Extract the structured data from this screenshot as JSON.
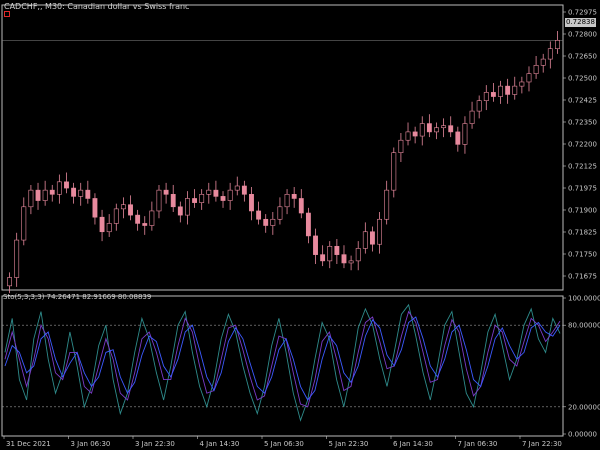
{
  "window": {
    "title": "CADCHF,, M30:  Canadian dollar vs Swiss franc",
    "last_price": "0.72838"
  },
  "indicator": {
    "label": "Sto(5,3,3,3) 74.26471 82.91669 80.08839"
  },
  "colors": {
    "background": "#000000",
    "candle": "#e88a9e",
    "axis": "#c8c8c8",
    "stoch_main": "#2e8b8b",
    "stoch_signal": "#7a3cc8",
    "stoch_third": "#3c5aff"
  },
  "chart_data": [
    {
      "type": "candlestick",
      "title": "CADCHF,, M30:  Canadian dollar vs Swiss franc",
      "y_ticks": [
        "0.72975",
        "0.72800",
        "0.72650",
        "0.72500",
        "0.72425",
        "0.72350",
        "0.72200",
        "0.72125",
        "0.71975",
        "0.71900",
        "0.71825",
        "0.71750",
        "0.71675"
      ],
      "x_ticks": [
        "31 Dec 2021",
        "3 Jan 06:30",
        "3 Jan 22:30",
        "4 Jan 14:30",
        "5 Jan 06:30",
        "5 Jan 22:30",
        "6 Jan 14:30",
        "7 Jan 06:30",
        "7 Jan 22:30"
      ],
      "ylim": [
        0.7164,
        0.7301
      ],
      "close": [
        0.717,
        0.7188,
        0.7204,
        0.7212,
        0.7207,
        0.7212,
        0.721,
        0.7216,
        0.7213,
        0.7209,
        0.7212,
        0.7208,
        0.7199,
        0.7192,
        0.7196,
        0.7203,
        0.7205,
        0.72,
        0.7196,
        0.7195,
        0.7202,
        0.7212,
        0.721,
        0.7204,
        0.72,
        0.7208,
        0.7206,
        0.721,
        0.7212,
        0.7209,
        0.7207,
        0.7212,
        0.7214,
        0.721,
        0.7202,
        0.7198,
        0.7195,
        0.7198,
        0.7204,
        0.721,
        0.7208,
        0.7201,
        0.719,
        0.7181,
        0.7178,
        0.7185,
        0.7181,
        0.7177,
        0.7178,
        0.7184,
        0.7192,
        0.7186,
        0.7198,
        0.7212,
        0.723,
        0.7236,
        0.724,
        0.7238,
        0.7244,
        0.724,
        0.7242,
        0.7243,
        0.724,
        0.7234,
        0.7244,
        0.725,
        0.7255,
        0.7259,
        0.7257,
        0.7262,
        0.7258,
        0.7262,
        0.7264,
        0.7268,
        0.7272,
        0.7275,
        0.728,
        0.7284
      ],
      "ohlc_note": "open of each bar equals previous close"
    },
    {
      "type": "line",
      "title": "Sto(5,3,3,3) 74.26471 82.91669 80.08839",
      "y_ticks": [
        "100.00000",
        "80.00000",
        "20.00000",
        "0.00000"
      ],
      "ylim": [
        0,
        100
      ],
      "levels": [
        80,
        20
      ],
      "series": [
        {
          "name": "74.26471",
          "values": [
            60,
            85,
            40,
            25,
            70,
            90,
            55,
            30,
            45,
            75,
            50,
            20,
            35,
            65,
            80,
            40,
            15,
            30,
            60,
            85,
            70,
            45,
            25,
            50,
            80,
            90,
            60,
            35,
            20,
            40,
            70,
            88,
            75,
            50,
            30,
            15,
            35,
            65,
            85,
            60,
            30,
            10,
            25,
            55,
            82,
            70,
            40,
            20,
            45,
            78,
            92,
            80,
            55,
            35,
            60,
            88,
            95,
            72,
            45,
            25,
            50,
            80,
            90,
            60,
            30,
            20,
            45,
            75,
            88,
            65,
            40,
            55,
            80,
            92,
            70,
            60,
            85,
            74
          ]
        },
        {
          "name": "82.91669",
          "values": [
            55,
            75,
            55,
            35,
            55,
            80,
            70,
            45,
            40,
            60,
            60,
            35,
            30,
            50,
            70,
            55,
            30,
            25,
            45,
            70,
            75,
            60,
            40,
            40,
            65,
            85,
            75,
            50,
            30,
            32,
            55,
            78,
            80,
            62,
            42,
            25,
            28,
            50,
            72,
            70,
            45,
            22,
            20,
            40,
            68,
            75,
            55,
            32,
            35,
            60,
            82,
            86,
            68,
            48,
            50,
            72,
            90,
            82,
            60,
            38,
            40,
            65,
            84,
            75,
            48,
            28,
            35,
            60,
            80,
            75,
            55,
            50,
            68,
            85,
            80,
            68,
            75,
            83
          ]
        },
        {
          "name": "80.08839",
          "values": [
            50,
            65,
            60,
            45,
            50,
            70,
            75,
            55,
            42,
            52,
            60,
            45,
            35,
            42,
            60,
            62,
            42,
            30,
            38,
            58,
            72,
            68,
            50,
            42,
            55,
            75,
            80,
            62,
            42,
            32,
            45,
            68,
            78,
            70,
            52,
            35,
            30,
            42,
            62,
            70,
            55,
            35,
            25,
            32,
            55,
            72,
            65,
            45,
            38,
            50,
            72,
            84,
            78,
            58,
            50,
            62,
            82,
            86,
            70,
            50,
            42,
            55,
            75,
            80,
            62,
            40,
            35,
            50,
            70,
            78,
            65,
            55,
            60,
            78,
            82,
            75,
            72,
            80
          ]
        }
      ]
    }
  ]
}
